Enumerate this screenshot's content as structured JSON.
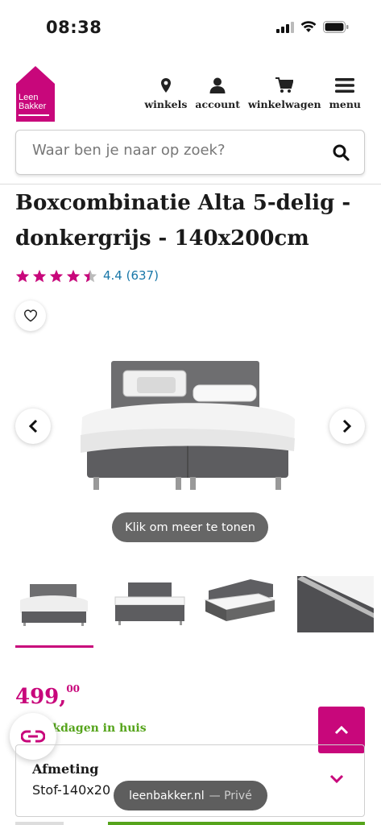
{
  "status_bar": {
    "time": "08:38"
  },
  "logo": {
    "line1": "Leen",
    "line2": "Bakker"
  },
  "nav": [
    {
      "label": "winkels",
      "icon": "location-pin-icon"
    },
    {
      "label": "account",
      "icon": "user-icon"
    },
    {
      "label": "winkelwagen",
      "icon": "cart-icon"
    },
    {
      "label": "menu",
      "icon": "hamburger-menu-icon"
    }
  ],
  "search": {
    "placeholder": "Waar ben je naar op zoek?"
  },
  "product": {
    "title": "Boxcombinatie Alta 5-delig - donkergrijs - 140x200cm",
    "rating_value": 4.4,
    "rating_text": "4.4 (637)",
    "more_label": "Klik om meer te tonen",
    "price_main": "499,",
    "price_cents": "00",
    "delivery": "rkdagen in huis"
  },
  "size_selector": {
    "label": "Afmeting",
    "value": "Stof-140x20"
  },
  "browser": {
    "domain": "leenbakker.nl",
    "mode": "— Privé"
  },
  "colors": {
    "brand": "#c8077b",
    "green": "#55a41b",
    "link": "#1877a8"
  }
}
